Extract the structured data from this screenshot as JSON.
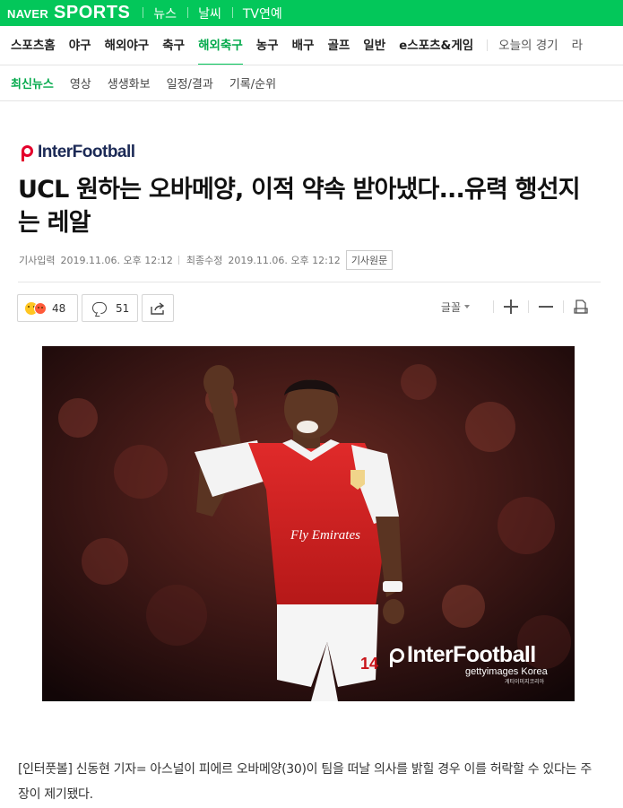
{
  "header": {
    "brand_naver": "NAVER",
    "brand_sports": "SPORTS",
    "links": [
      "뉴스",
      "날씨",
      "TV연예"
    ],
    "accent_color": "#03c75a"
  },
  "main_nav": {
    "items": [
      "스포츠홈",
      "야구",
      "해외야구",
      "축구",
      "해외축구",
      "농구",
      "배구",
      "골프",
      "일반",
      "e스포츠&게임"
    ],
    "active": "해외축구",
    "today_label": "오늘의 경기",
    "overflow_label": "라"
  },
  "sub_nav": {
    "items": [
      "최신뉴스",
      "영상",
      "생생화보",
      "일정/결과",
      "기록/순위"
    ],
    "active": "최신뉴스"
  },
  "article": {
    "press": "InterFootball",
    "title": "UCL 원하는 오바메양, 이적 약속 받아냈다...유력 행선지는 레알",
    "input_label": "기사입력",
    "input_time": "2019.11.06. 오후 12:12",
    "edit_label": "최종수정",
    "edit_time": "2019.11.06. 오후 12:12",
    "original_link": "기사원문",
    "body": "[인터풋볼] 신동현 기자= 아스널이 피에르 오바메양(30)이 팀을 떠날 의사를 밝힐 경우 이를 허락할 수 있다는 주장이 제기됐다."
  },
  "tools": {
    "reaction_count": "48",
    "comment_count": "51",
    "font_label": "글꼴",
    "icons": [
      "emoji-reaction-icon",
      "comment-icon",
      "share-icon",
      "plus-icon",
      "minus-icon",
      "print-icon"
    ]
  },
  "photo": {
    "watermark": "InterFootball",
    "credit": "gettyimages Korea",
    "credit_sub": "게티이미지코리아",
    "jersey_sponsor": "Fly Emirates",
    "jersey_number": "14"
  }
}
